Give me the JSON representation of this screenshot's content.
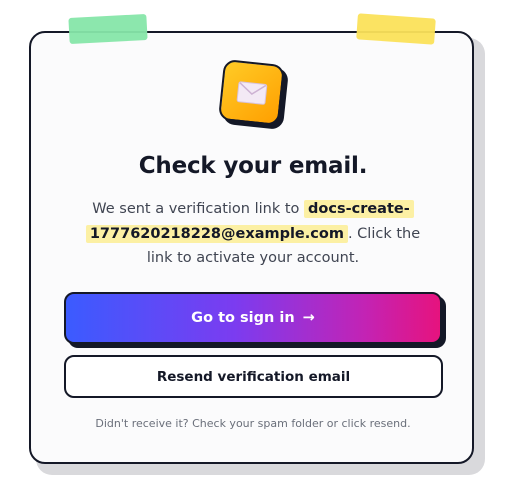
{
  "verify": {
    "title": "Check your email.",
    "message_before": "We sent a verification link to",
    "email": "docs-create-1777620218228@example.com",
    "message_after": ". Click the link to activate your account.",
    "primary_button": {
      "label": "Go to sign in",
      "arrow": "→"
    },
    "secondary_button_label": "Resend verification email",
    "footnote": "Didn't receive it? Check your spam folder or click resend."
  },
  "icons": {
    "tile": "envelope-icon",
    "button_arrow": "arrow-right-icon"
  },
  "colors": {
    "ink": "#141827",
    "tape_left": "#86e6a9",
    "tape_right": "#fbe15a",
    "icon_tile": "#ffb300",
    "highlight": "#fcf0a4",
    "gradient_start": "#3b5bff",
    "gradient_end": "#e6137e"
  }
}
